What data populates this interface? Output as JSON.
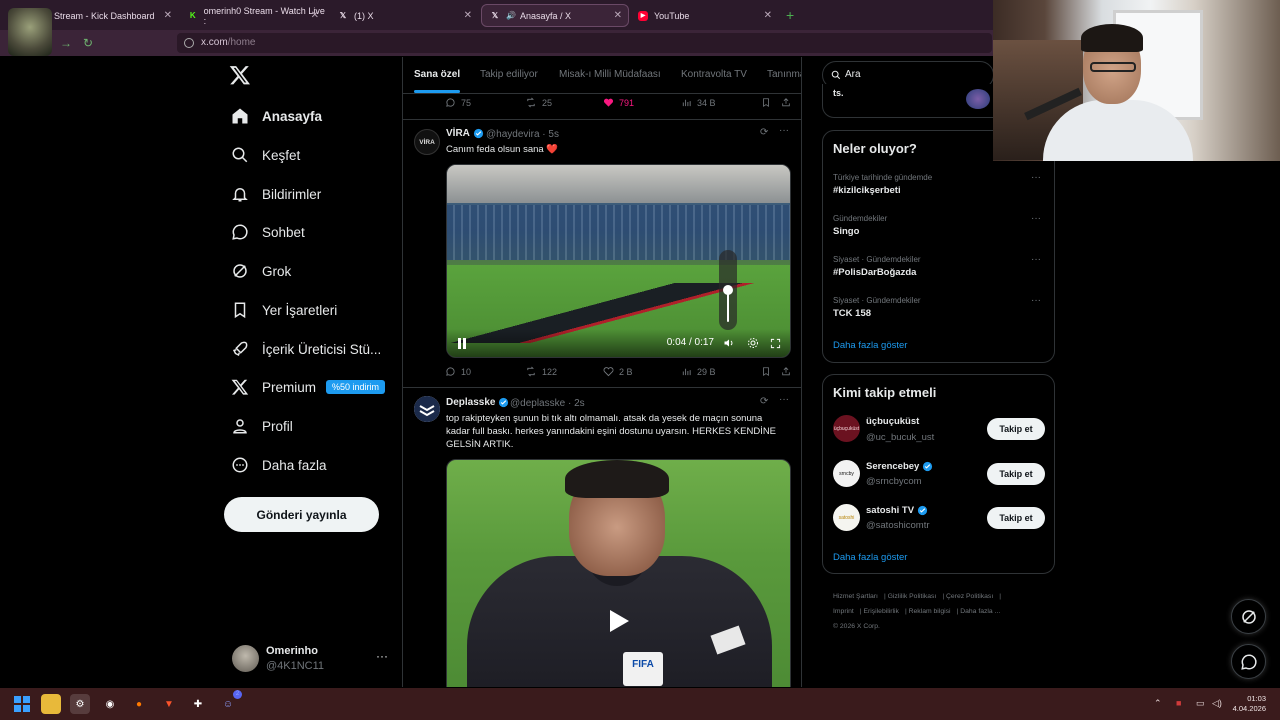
{
  "browser": {
    "tabs": [
      {
        "title": "Stream - Kick Dashboard",
        "icon": "kick-icon",
        "active": false
      },
      {
        "title": "omerinh0 Stream - Watch Live :",
        "icon": "kick-icon",
        "active": false
      },
      {
        "title": "(1) X",
        "icon": "x-icon",
        "active": false
      },
      {
        "title": "Anasayfa / X",
        "icon": "x-icon",
        "active": true
      },
      {
        "title": "YouTube",
        "icon": "youtube-icon",
        "active": false
      }
    ],
    "new_tab": "+",
    "url_host": "x.com",
    "url_path": "/home"
  },
  "nav": {
    "items": [
      {
        "label": "Anasayfa",
        "icon": "home-icon"
      },
      {
        "label": "Keşfet",
        "icon": "search-icon"
      },
      {
        "label": "Bildirimler",
        "icon": "bell-icon"
      },
      {
        "label": "Sohbet",
        "icon": "chat-icon"
      },
      {
        "label": "Grok",
        "icon": "grok-icon"
      },
      {
        "label": "Yer İşaretleri",
        "icon": "bookmark-icon"
      },
      {
        "label": "İçerik Üreticisi Stü...",
        "icon": "rocket-icon"
      },
      {
        "label": "Premium",
        "icon": "x-premium-icon"
      },
      {
        "label": "Profil",
        "icon": "person-icon"
      },
      {
        "label": "Daha fazla",
        "icon": "more-circle-icon"
      }
    ],
    "premium_badge": "%50 indirim",
    "post_button": "Gönderi yayınla",
    "account": {
      "name": "Omerinho",
      "handle": "@4K1NC11",
      "more": "···"
    }
  },
  "timeline": {
    "tabs": [
      "Sana özel",
      "Takip ediliyor",
      "Misak-ı Milli Müdafaası",
      "Kontravolta TV",
      "Tanınma"
    ],
    "prev_actions": {
      "replies": "75",
      "reposts": "25",
      "likes": "791",
      "views": "34 B"
    },
    "tweets": [
      {
        "name": "VİRA",
        "handle": "@haydevira · 5s",
        "avatar_text": "VİRA",
        "text": "Canım feda olsun sana",
        "emoji": "❤️",
        "video": {
          "time": "0:04 / 0:17",
          "volume": 0.5
        },
        "actions": {
          "replies": "10",
          "reposts": "122",
          "likes": "2 B",
          "views": "29 B"
        }
      },
      {
        "name": "Deplasske",
        "handle": "@deplasske · 2s",
        "text_lines": [
          "top rakipteyken şunun bi tık altı olmamalı. atsak da yesek de maçın sonuna",
          "kadar full baskı. herkes yanındakini eşini dostunu uyarsın. HERKES KENDİNE",
          "GELSİN ARTIK."
        ],
        "video_badge": "FIFA"
      }
    ]
  },
  "right": {
    "search_placeholder": "Ara",
    "peek_text": "ts.",
    "trends_title": "Neler oluyor?",
    "trends": [
      {
        "category": "Türkiye tarihinde gündemde",
        "name": "#kizilcikşerbeti"
      },
      {
        "category": "Gündemdekiler",
        "name": "Singo"
      },
      {
        "category": "Siyaset · Gündemdekiler",
        "name": "#PolisDarBoğazda"
      },
      {
        "category": "Siyaset · Gündemdekiler",
        "name": "TCK 158"
      }
    ],
    "show_more": "Daha fazla göster",
    "who_title": "Kimi takip etmeli",
    "who": [
      {
        "name": "üçbuçuküst",
        "handle": "@uc_bucuk_ust",
        "verified": false,
        "button": "Takip et",
        "avatar_text": "üçbuçuküst",
        "color": "#6b1220"
      },
      {
        "name": "Serencebey",
        "handle": "@srncbycom",
        "verified": true,
        "button": "Takip et",
        "avatar_text": "srncby",
        "color": "#f2f2f2"
      },
      {
        "name": "satoshi TV",
        "handle": "@satoshicomtr",
        "verified": true,
        "button": "Takip et",
        "avatar_text": "satoshi",
        "color": "#f5f5f0"
      }
    ],
    "show_more_2": "Daha fazla göster",
    "footer": [
      "Hizmet Şartları",
      "Gizlilik Politikası",
      "Çerez Politikası",
      "Imprint",
      "Erişilebilirlik",
      "Reklam bilgisi",
      "Daha fazla ...",
      "© 2026 X Corp."
    ]
  },
  "taskbar": {
    "time": "01:03",
    "date": "4.04.2026",
    "chat_badge": "2"
  },
  "colors": {
    "accent": "#1d9bf0",
    "like": "#f91880",
    "bg": "#000000"
  }
}
